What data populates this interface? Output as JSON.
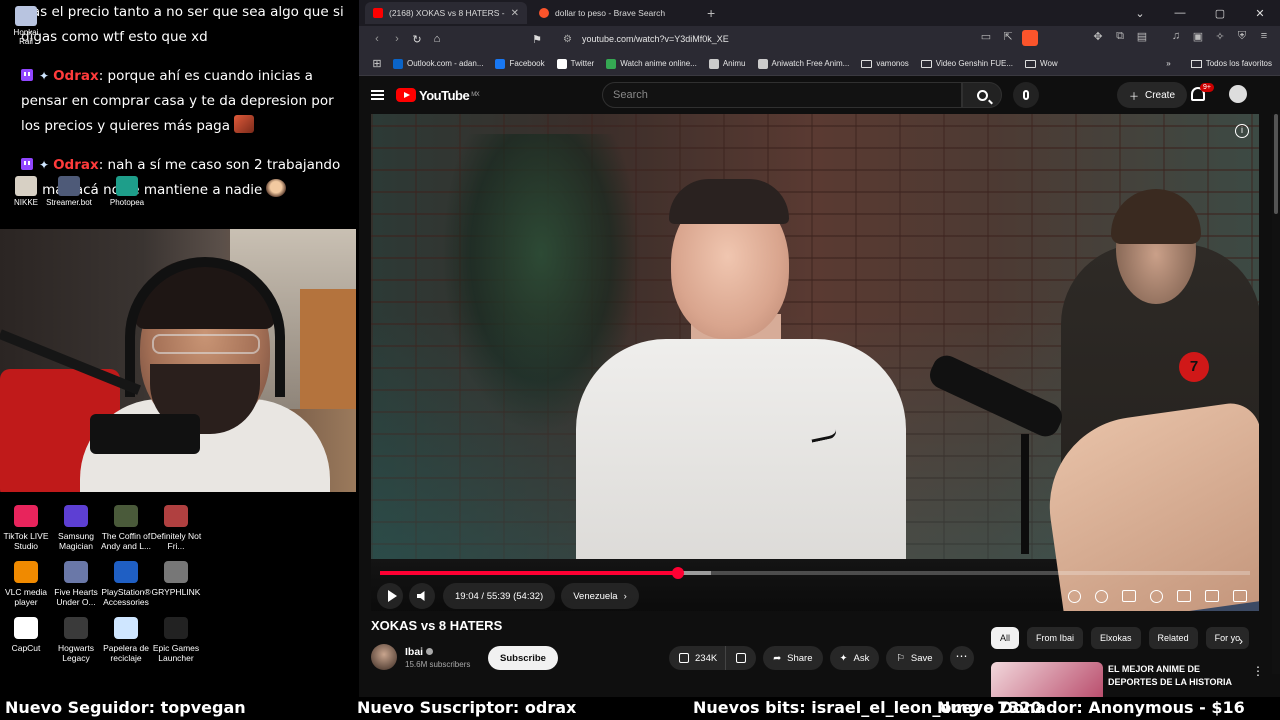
{
  "chat": {
    "messages": [
      {
        "user": "",
        "text": "tras el precio tanto a no ser que sea algo que si digas como wtf esto que xd"
      },
      {
        "user": "Odrax",
        "text": ": porque ahí es cuando inicias a pensar en comprar casa y te da depresion por los precios y quieres más paga"
      },
      {
        "user": "Odrax",
        "text": ": nah a sí me caso son 2 trabajando no mas acá no se mantiene a nadie"
      }
    ]
  },
  "desktop_top": [
    {
      "label": "Honkai Rail",
      "icon": "honkai-icon",
      "color": "#b8c4e0"
    },
    {
      "label": "NIKKE",
      "icon": "nikke-icon",
      "color": "#d7d0c4"
    },
    {
      "label": "Streamer.bot",
      "icon": "streamerbot-icon",
      "color": "#4e5a78"
    },
    {
      "label": "Photopea",
      "icon": "photopea-icon",
      "color": "#1e9e8a"
    }
  ],
  "desktop": [
    {
      "label": "TikTok LIVE Studio",
      "icon": "tiktok-live-icon",
      "color": "#e8245c"
    },
    {
      "label": "Samsung Magician",
      "icon": "samsung-magician-icon",
      "color": "#5d3fd3"
    },
    {
      "label": "The Coffin of Andy and L...",
      "icon": "coffin-game-icon",
      "color": "#4a5a3a"
    },
    {
      "label": "Definitely Not Fri...",
      "icon": "definitely-not-icon",
      "color": "#b04040"
    },
    {
      "label": "VLC media player",
      "icon": "vlc-icon",
      "color": "#f08a00"
    },
    {
      "label": "Five Hearts Under O...",
      "icon": "five-hearts-icon",
      "color": "#6a78a8"
    },
    {
      "label": "PlayStation® Accessories",
      "icon": "playstation-icon",
      "color": "#1f5fc4"
    },
    {
      "label": "GRYPHLINK",
      "icon": "gryphlink-icon",
      "color": "#777"
    },
    {
      "label": "CapCut",
      "icon": "capcut-icon",
      "color": "#ffffff"
    },
    {
      "label": "Hogwarts Legacy",
      "icon": "hogwarts-icon",
      "color": "#3a3a3a"
    },
    {
      "label": "Papelera de reciclaje",
      "icon": "recycle-bin-icon",
      "color": "#cfe6ff"
    },
    {
      "label": "Epic Games Launcher",
      "icon": "epic-games-icon",
      "color": "#222"
    }
  ],
  "browser": {
    "tabs": [
      {
        "label": "(2168) XOKAS vs 8 HATERS -",
        "icon": "youtube-tab-icon",
        "color": "#ff0000",
        "active": true
      },
      {
        "label": "dollar to peso - Brave Search",
        "icon": "brave-search-tab-icon",
        "color": "#fb542b",
        "active": false
      }
    ],
    "url": "youtube.com/watch?v=Y3diMf0k_XE",
    "bookmarks": [
      {
        "label": "Outlook.com - adan...",
        "color": "#0a64c8"
      },
      {
        "label": "Facebook",
        "color": "#1877f2"
      },
      {
        "label": "Twitter",
        "color": "#ffffff"
      },
      {
        "label": "Watch anime online...",
        "color": "#35a853"
      },
      {
        "label": "Animu",
        "color": "#cccccc"
      },
      {
        "label": "Aniwatch Free Anim...",
        "color": "#cccccc"
      },
      {
        "label": "vamonos",
        "folder": true
      },
      {
        "label": "Video Genshin FUE...",
        "folder": true
      },
      {
        "label": "Wow",
        "folder": true
      }
    ],
    "bookmarks_all": "Todos los favoritos"
  },
  "youtube": {
    "logo": "YouTube",
    "region": "MX",
    "search_placeholder": "Search",
    "create": "Create",
    "notifications": "9+",
    "time": "19:04 / 55:39 (54:32)",
    "chapter": "Venezuela",
    "progress_fraction": 0.342,
    "buffered_fraction": 0.38,
    "video_badge_number": "7",
    "title": "XOKAS vs 8 HATERS",
    "channel": "Ibai",
    "subscribers": "15.6M subscribers",
    "subscribe": "Subscribe",
    "likes": "234K",
    "share": "Share",
    "ask": "Ask",
    "save": "Save",
    "chips": [
      "All",
      "From Ibai",
      "Elxokas",
      "Related",
      "For yo"
    ],
    "rec_title": "EL MEJOR ANIME DE DEPORTES DE LA HISTORIA"
  },
  "alerts": {
    "follower": "Nuevo Seguidor: topvegan",
    "subscriber": "Nuevo Suscriptor: odrax",
    "bits": "Nuevos bits: israel_el_leon_omg - 7320",
    "donor": "Nuevo Donador: Anonymous - $16"
  }
}
